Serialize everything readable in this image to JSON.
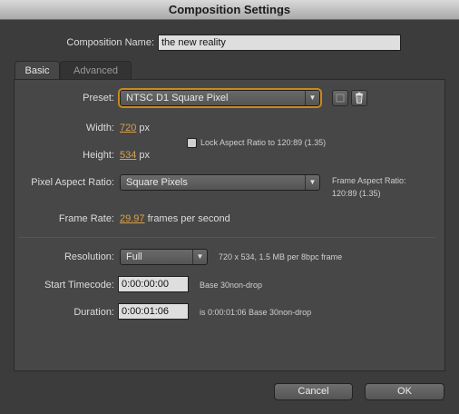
{
  "window": {
    "title": "Composition Settings"
  },
  "comp_name": {
    "label": "Composition Name:",
    "value": "the new reality"
  },
  "tabs": [
    {
      "label": "Basic"
    },
    {
      "label": "Advanced"
    }
  ],
  "preset": {
    "label": "Preset:",
    "value": "NTSC D1 Square Pixel"
  },
  "width": {
    "label": "Width:",
    "value": "720",
    "unit": "px"
  },
  "height": {
    "label": "Height:",
    "value": "534",
    "unit": "px"
  },
  "lock_aspect": {
    "label": "Lock Aspect Ratio to 120:89 (1.35)",
    "checked": false
  },
  "pixel_aspect": {
    "label": "Pixel Aspect Ratio:",
    "value": "Square Pixels"
  },
  "frame_aspect": {
    "label": "Frame Aspect Ratio:",
    "value": "120:89 (1.35)"
  },
  "frame_rate": {
    "label": "Frame Rate:",
    "value": "29.97",
    "unit": "frames per second"
  },
  "resolution": {
    "label": "Resolution:",
    "value": "Full",
    "info": "720 x 534, 1.5 MB per 8bpc frame"
  },
  "start_timecode": {
    "label": "Start Timecode:",
    "value": "0:00:00:00",
    "info": "Base 30non-drop"
  },
  "duration": {
    "label": "Duration:",
    "value": "0:00:01:06",
    "info": "is 0:00:01:06  Base 30non-drop"
  },
  "buttons": {
    "cancel": "Cancel",
    "ok": "OK"
  },
  "icons": {
    "preset_save": "save-preset-icon",
    "preset_delete": "trash-icon"
  },
  "colors": {
    "accent": "#c98a1b",
    "hot_text": "#d9a24a"
  }
}
